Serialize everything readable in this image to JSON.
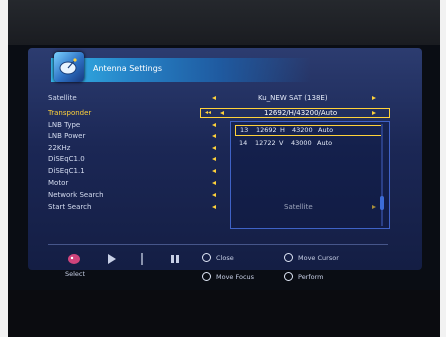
{
  "window": {
    "title": "Antenna Settings",
    "logo_icon": "satellite-dish-icon"
  },
  "menu": {
    "items": [
      {
        "label": "Satellite",
        "value": "Ku_NEW SAT (138E)",
        "arrows": true
      },
      {
        "label": "Transponder",
        "value": "12692/H/43200/Auto",
        "arrows": true,
        "active": true
      },
      {
        "label": "LNB Type",
        "value": "",
        "arrows": true
      },
      {
        "label": "LNB Power",
        "value": "",
        "arrows": true
      },
      {
        "label": "22KHz",
        "value": "",
        "arrows": true
      },
      {
        "label": "DiSEqC1.0",
        "value": "",
        "arrows": true
      },
      {
        "label": "DiSEqC1.1",
        "value": "",
        "arrows": true
      },
      {
        "label": "Motor",
        "value": "",
        "arrows": true
      },
      {
        "label": "Network Search",
        "value": "",
        "arrows": true
      },
      {
        "label": "Start Search",
        "value": "Satellite",
        "arrows": true
      }
    ]
  },
  "transponder_list": {
    "rows": [
      {
        "num": "13",
        "freq": "12692",
        "pol": "H",
        "sym": "43200",
        "fec": "Auto",
        "selected": true
      },
      {
        "num": "14",
        "freq": "12722",
        "pol": "V",
        "sym": "43000",
        "fec": "Auto",
        "selected": false
      }
    ]
  },
  "help_bar": {
    "select_label": "Select",
    "close_label": "Close",
    "move_cursor_label": "Move Cursor",
    "move_focus_label": "Move Focus",
    "perform_label": "Perform"
  },
  "colors": {
    "accent": "#ffd23a",
    "panel": "#1b2755",
    "title_gradient": "#35b6e8"
  }
}
